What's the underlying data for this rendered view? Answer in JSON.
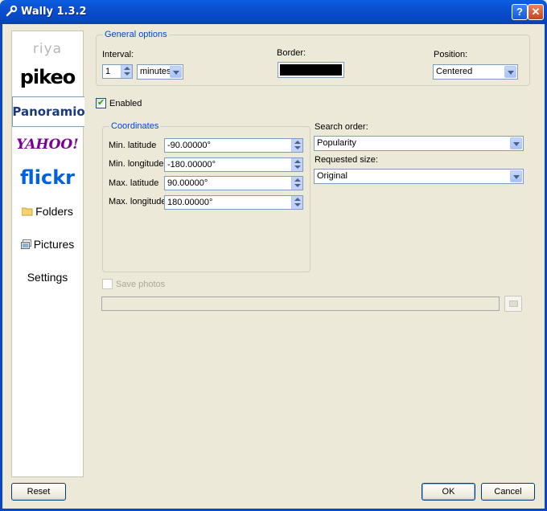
{
  "window": {
    "title": "Wally 1.3.2",
    "help_glyph": "?",
    "close_glyph": "✕"
  },
  "sidebar": {
    "items": [
      {
        "label": "riya"
      },
      {
        "label": "pikeo"
      },
      {
        "label": "Panoramio"
      },
      {
        "label": "YAHOO!"
      },
      {
        "label": "flickr"
      },
      {
        "label": "Folders"
      },
      {
        "label": "Pictures"
      },
      {
        "label": "Settings"
      }
    ],
    "selected": "Panoramio"
  },
  "general": {
    "title": "General options",
    "interval_label": "Interval:",
    "interval_value": "1",
    "interval_unit": "minutes",
    "border_label": "Border:",
    "border_color": "#000000",
    "position_label": "Position:",
    "position_value": "Centered"
  },
  "enabled": {
    "label": "Enabled",
    "checked": true
  },
  "coordinates": {
    "title": "Coordinates",
    "rows": [
      {
        "label": "Min. latitude",
        "value": "-90.00000°"
      },
      {
        "label": "Min. longitude",
        "value": "-180.00000°"
      },
      {
        "label": "Max. latitude",
        "value": "90.00000°"
      },
      {
        "label": "Max. longitude",
        "value": "180.00000°"
      }
    ]
  },
  "search_order": {
    "label": "Search order:",
    "value": "Popularity"
  },
  "requested_size": {
    "label": "Requested size:",
    "value": "Original"
  },
  "save_photos": {
    "label": "Save photos",
    "checked": false,
    "path": ""
  },
  "buttons": {
    "reset": "Reset",
    "ok": "OK",
    "cancel": "Cancel"
  },
  "colors": {
    "titlebar": "#0846c3",
    "group_title": "#0046d5",
    "background": "#ece9d8"
  }
}
